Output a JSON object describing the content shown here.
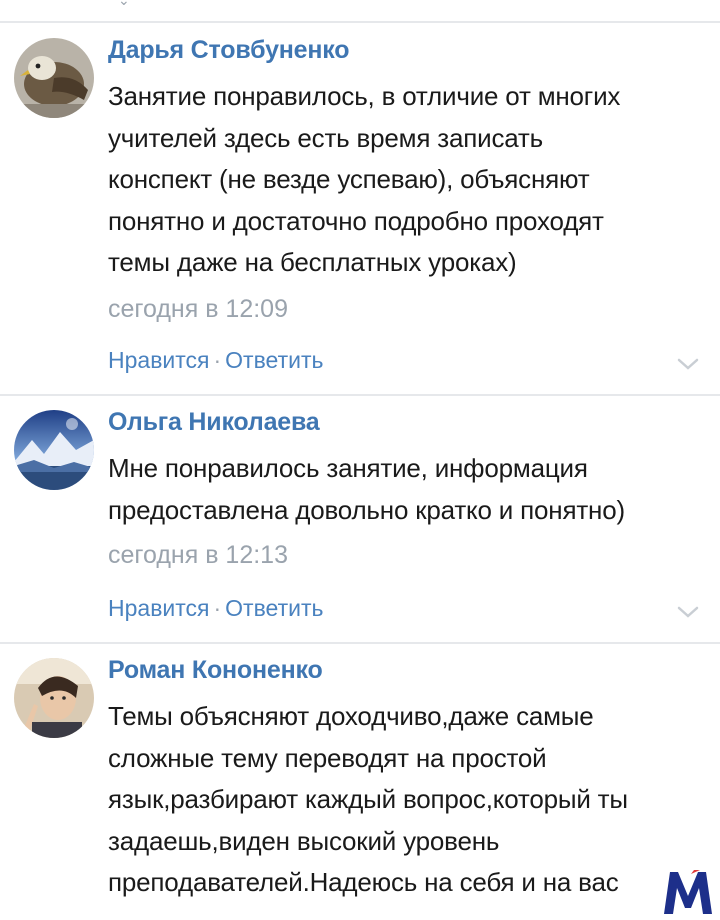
{
  "comments": [
    {
      "author": "Дарья Стовбуненко",
      "lines": [
        "Занятие понравилось, в отличие от многих",
        "учителей здесь есть время записать",
        "конспект (не везде успеваю), объясняют",
        "понятно и достаточно подробно проходят",
        "темы даже на бесплатных уроках)"
      ],
      "time": "сегодня в 12:09",
      "like": "Нравится",
      "sep": "·",
      "reply": "Ответить",
      "avatar_icon": "eagle-avatar"
    },
    {
      "author": "Ольга Николаева",
      "lines": [
        "Мне понравилось занятие, информация",
        "предоставлена довольно кратко и понятно)"
      ],
      "time": "сегодня в 12:13",
      "like": "Нравится",
      "sep": "·",
      "reply": "Ответить",
      "avatar_icon": "mountain-landscape-avatar"
    },
    {
      "author": "Роман Кононенко",
      "lines": [
        "Темы объясняют доходчиво,даже самые",
        "сложные тему переводят на простой",
        "язык,разбирают каждый вопрос,который ты",
        "задаешь,виден высокий уровень",
        "преподавателей.Надеюсь на себя и на вас"
      ],
      "avatar_icon": "person-photo-avatar"
    }
  ],
  "colors": {
    "author": "#3f76b2",
    "link": "#4a82bf",
    "muted": "#9aa3ad",
    "divider": "#e6e8eb",
    "text": "#1a1a1a",
    "logo": "#1d2f8a"
  }
}
